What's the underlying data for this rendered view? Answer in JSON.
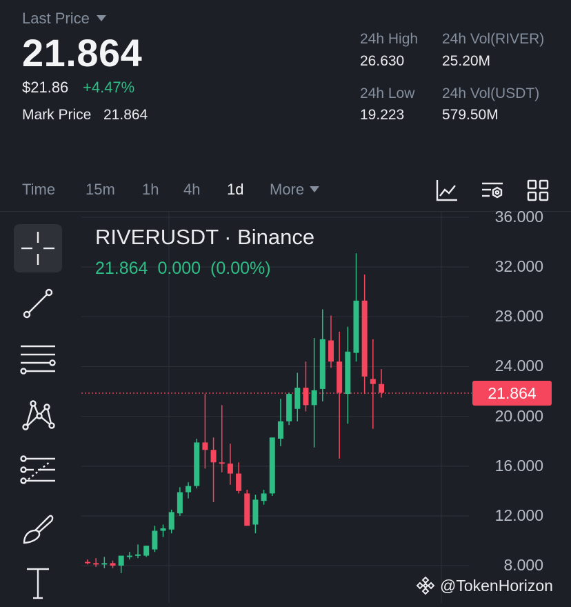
{
  "ticker": {
    "last_price_label": "Last Price",
    "last_price": "21.864",
    "usd_price": "$21.86",
    "change_pct": "+4.47%",
    "mark_price_label": "Mark Price",
    "mark_price": "21.864"
  },
  "stats": {
    "high_label": "24h High",
    "high": "26.630",
    "vol_base_label": "24h Vol(RIVER)",
    "vol_base": "25.20M",
    "low_label": "24h Low",
    "low": "19.223",
    "vol_quote_label": "24h Vol(USDT)",
    "vol_quote": "579.50M"
  },
  "timeframes": {
    "time": "Time",
    "m15": "15m",
    "h1": "1h",
    "h4": "4h",
    "d1": "1d",
    "more": "More",
    "active": "1d"
  },
  "toolbar_icons": [
    "chart-style-icon",
    "indicator-settings-icon",
    "layout-grid-icon"
  ],
  "drawing_tools": [
    "crosshair-icon",
    "trend-line-icon",
    "horizontal-lines-icon",
    "pattern-icon",
    "fibonacci-icon",
    "brush-icon",
    "text-tool-icon"
  ],
  "chart": {
    "symbol_title": "RIVERUSDT · Binance",
    "ohlc_price": "21.864",
    "ohlc_change": "0.000",
    "ohlc_change_pct": "(0.00%)",
    "current_price_tag": "21.864",
    "watermark": "@TokenHorizon"
  },
  "colors": {
    "up": "#2ebd85",
    "down": "#f6465d",
    "background": "#1c1f26"
  },
  "chart_data": {
    "type": "candlestick",
    "title": "RIVERUSDT · Binance",
    "y_ticks": [
      "36.000",
      "32.000",
      "28.000",
      "24.000",
      "20.000",
      "16.000",
      "12.000",
      "8.000"
    ],
    "ylim": [
      8.0,
      36.0
    ],
    "current_price": 21.864,
    "grid": true,
    "candles": [
      {
        "o": 8.3,
        "h": 8.5,
        "l": 8.1,
        "c": 8.2
      },
      {
        "o": 8.2,
        "h": 8.6,
        "l": 7.9,
        "c": 8.1
      },
      {
        "o": 8.1,
        "h": 8.7,
        "l": 7.8,
        "c": 8.2
      },
      {
        "o": 8.2,
        "h": 8.4,
        "l": 7.8,
        "c": 8.0
      },
      {
        "o": 8.0,
        "h": 8.5,
        "l": 7.4,
        "c": 8.8
      },
      {
        "o": 8.8,
        "h": 9.1,
        "l": 8.5,
        "c": 8.8
      },
      {
        "o": 8.8,
        "h": 9.7,
        "l": 8.6,
        "c": 8.9
      },
      {
        "o": 8.8,
        "h": 9.6,
        "l": 8.7,
        "c": 9.6
      },
      {
        "o": 9.3,
        "h": 11.2,
        "l": 9.1,
        "c": 10.8
      },
      {
        "o": 10.8,
        "h": 11.3,
        "l": 10.3,
        "c": 11.0
      },
      {
        "o": 10.9,
        "h": 12.5,
        "l": 10.6,
        "c": 12.3
      },
      {
        "o": 12.2,
        "h": 14.3,
        "l": 12.0,
        "c": 13.9
      },
      {
        "o": 13.9,
        "h": 14.7,
        "l": 13.4,
        "c": 14.4
      },
      {
        "o": 14.4,
        "h": 18.2,
        "l": 14.2,
        "c": 17.9
      },
      {
        "o": 17.9,
        "h": 21.8,
        "l": 15.8,
        "c": 17.3
      },
      {
        "o": 17.3,
        "h": 18.3,
        "l": 13.1,
        "c": 16.3
      },
      {
        "o": 16.3,
        "h": 20.9,
        "l": 15.5,
        "c": 16.2
      },
      {
        "o": 16.2,
        "h": 17.8,
        "l": 14.5,
        "c": 15.4
      },
      {
        "o": 15.4,
        "h": 16.3,
        "l": 13.8,
        "c": 14.0
      },
      {
        "o": 13.8,
        "h": 14.1,
        "l": 11.3,
        "c": 11.2
      },
      {
        "o": 11.3,
        "h": 13.7,
        "l": 10.6,
        "c": 13.3
      },
      {
        "o": 13.2,
        "h": 14.1,
        "l": 12.9,
        "c": 13.8
      },
      {
        "o": 13.8,
        "h": 16.5,
        "l": 13.6,
        "c": 18.3
      },
      {
        "o": 18.2,
        "h": 21.4,
        "l": 17.6,
        "c": 19.6
      },
      {
        "o": 19.6,
        "h": 21.9,
        "l": 19.3,
        "c": 21.8
      },
      {
        "o": 20.6,
        "h": 23.5,
        "l": 19.6,
        "c": 22.3
      },
      {
        "o": 22.3,
        "h": 24.4,
        "l": 20.4,
        "c": 20.9
      },
      {
        "o": 20.9,
        "h": 26.3,
        "l": 17.5,
        "c": 22.1
      },
      {
        "o": 22.2,
        "h": 28.6,
        "l": 21.2,
        "c": 26.2
      },
      {
        "o": 26.1,
        "h": 28.1,
        "l": 23.9,
        "c": 24.4
      },
      {
        "o": 24.4,
        "h": 26.8,
        "l": 16.6,
        "c": 21.9
      },
      {
        "o": 21.8,
        "h": 27.2,
        "l": 19.4,
        "c": 25.2
      },
      {
        "o": 25.1,
        "h": 33.1,
        "l": 24.4,
        "c": 29.3
      },
      {
        "o": 29.3,
        "h": 31.4,
        "l": 21.8,
        "c": 23.2
      },
      {
        "o": 23.0,
        "h": 26.2,
        "l": 19.0,
        "c": 22.6
      },
      {
        "o": 22.6,
        "h": 23.8,
        "l": 21.5,
        "c": 21.9
      }
    ]
  }
}
